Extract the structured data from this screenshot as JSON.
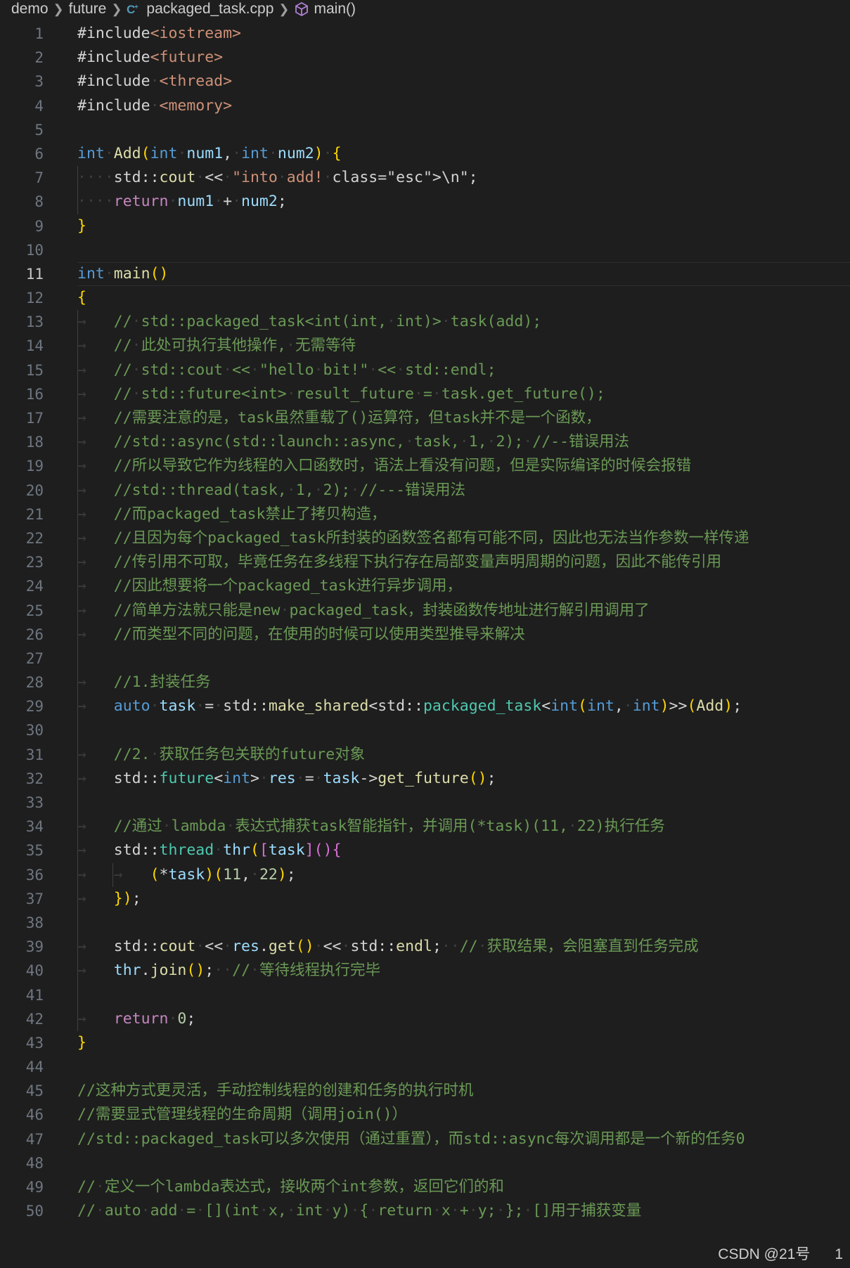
{
  "breadcrumb": {
    "items": [
      "demo",
      "future",
      "packaged_task.cpp",
      "main()"
    ]
  },
  "editor": {
    "active_line": 11,
    "lines": [
      "#include<iostream>",
      "#include<future>",
      "#include <thread>",
      "#include <memory>",
      "",
      "int Add(int num1, int num2) {",
      "    std::cout << \"into add!\\n\";",
      "    return num1 + num2;",
      "}",
      "",
      "int main()",
      "{",
      "    // std::packaged_task<int(int, int)> task(add);",
      "    // 此处可执行其他操作, 无需等待",
      "    // std::cout << \"hello bit!\" << std::endl;",
      "    // std::future<int> result_future = task.get_future();",
      "    //需要注意的是，task虽然重载了()运算符，但task并不是一个函数，",
      "    //std::async(std::launch::async, task, 1, 2); //--错误用法",
      "    //所以导致它作为线程的入口函数时，语法上看没有问题，但是实际编译的时候会报错",
      "    //std::thread(task, 1, 2); //---错误用法",
      "    //而packaged_task禁止了拷贝构造，",
      "    //且因为每个packaged_task所封装的函数签名都有可能不同，因此也无法当作参数一样传递",
      "    //传引用不可取，毕竟任务在多线程下执行存在局部变量声明周期的问题，因此不能传引用",
      "    //因此想要将一个packaged_task进行异步调用，",
      "    //简单方法就只能是new packaged_task，封装函数传地址进行解引用调用了",
      "    //而类型不同的问题，在使用的时候可以使用类型推导来解决",
      "",
      "    //1.封装任务",
      "    auto task = std::make_shared<std::packaged_task<int(int, int)>>(Add);",
      "",
      "    //2. 获取任务包关联的future对象",
      "    std::future<int> res = task->get_future();",
      "",
      "    //通过 lambda 表达式捕获task智能指针，并调用(*task)(11, 22)执行任务",
      "    std::thread thr([task](){",
      "        (*task)(11, 22);",
      "    });",
      "",
      "    std::cout << res.get() << std::endl;  // 获取结果，会阻塞直到任务完成",
      "    thr.join();  // 等待线程执行完毕",
      "",
      "    return 0;",
      "}",
      "",
      "//这种方式更灵活，手动控制线程的创建和任务的执行时机",
      "//需要显式管理线程的生命周期（调用join()）",
      "//std::packaged_task可以多次使用（通过重置），而std::async每次调用都是一个新的任务0",
      "",
      "// 定义一个lambda表达式，接收两个int参数，返回它们的和",
      "// auto add = [](int x, int y) { return x + y; }; []用于捕获变量"
    ]
  },
  "watermark": "CSDN @21号      1",
  "colors": {
    "background": "#1e1e1e",
    "keyword": "#569cd6",
    "comment": "#6a9955",
    "string": "#ce9178",
    "type": "#4ec9b0",
    "function": "#dcdcaa",
    "line_number": "#6e7681"
  }
}
